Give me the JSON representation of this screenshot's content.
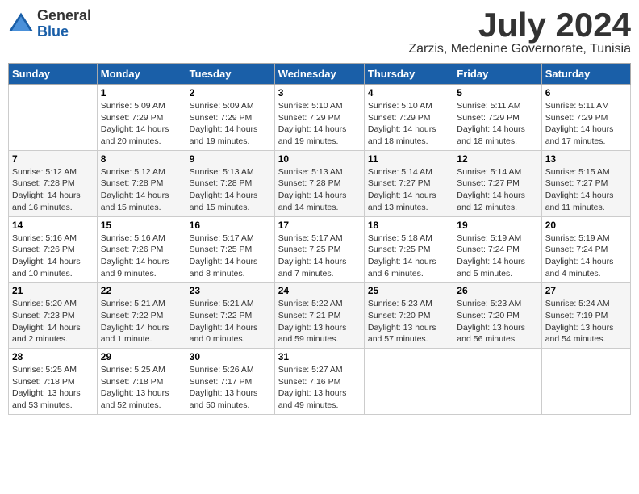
{
  "logo": {
    "general": "General",
    "blue": "Blue"
  },
  "title": {
    "month": "July 2024",
    "location": "Zarzis, Medenine Governorate, Tunisia"
  },
  "headers": [
    "Sunday",
    "Monday",
    "Tuesday",
    "Wednesday",
    "Thursday",
    "Friday",
    "Saturday"
  ],
  "weeks": [
    [
      {
        "day": "",
        "info": ""
      },
      {
        "day": "1",
        "info": "Sunrise: 5:09 AM\nSunset: 7:29 PM\nDaylight: 14 hours\nand 20 minutes."
      },
      {
        "day": "2",
        "info": "Sunrise: 5:09 AM\nSunset: 7:29 PM\nDaylight: 14 hours\nand 19 minutes."
      },
      {
        "day": "3",
        "info": "Sunrise: 5:10 AM\nSunset: 7:29 PM\nDaylight: 14 hours\nand 19 minutes."
      },
      {
        "day": "4",
        "info": "Sunrise: 5:10 AM\nSunset: 7:29 PM\nDaylight: 14 hours\nand 18 minutes."
      },
      {
        "day": "5",
        "info": "Sunrise: 5:11 AM\nSunset: 7:29 PM\nDaylight: 14 hours\nand 18 minutes."
      },
      {
        "day": "6",
        "info": "Sunrise: 5:11 AM\nSunset: 7:29 PM\nDaylight: 14 hours\nand 17 minutes."
      }
    ],
    [
      {
        "day": "7",
        "info": "Sunrise: 5:12 AM\nSunset: 7:28 PM\nDaylight: 14 hours\nand 16 minutes."
      },
      {
        "day": "8",
        "info": "Sunrise: 5:12 AM\nSunset: 7:28 PM\nDaylight: 14 hours\nand 15 minutes."
      },
      {
        "day": "9",
        "info": "Sunrise: 5:13 AM\nSunset: 7:28 PM\nDaylight: 14 hours\nand 15 minutes."
      },
      {
        "day": "10",
        "info": "Sunrise: 5:13 AM\nSunset: 7:28 PM\nDaylight: 14 hours\nand 14 minutes."
      },
      {
        "day": "11",
        "info": "Sunrise: 5:14 AM\nSunset: 7:27 PM\nDaylight: 14 hours\nand 13 minutes."
      },
      {
        "day": "12",
        "info": "Sunrise: 5:14 AM\nSunset: 7:27 PM\nDaylight: 14 hours\nand 12 minutes."
      },
      {
        "day": "13",
        "info": "Sunrise: 5:15 AM\nSunset: 7:27 PM\nDaylight: 14 hours\nand 11 minutes."
      }
    ],
    [
      {
        "day": "14",
        "info": "Sunrise: 5:16 AM\nSunset: 7:26 PM\nDaylight: 14 hours\nand 10 minutes."
      },
      {
        "day": "15",
        "info": "Sunrise: 5:16 AM\nSunset: 7:26 PM\nDaylight: 14 hours\nand 9 minutes."
      },
      {
        "day": "16",
        "info": "Sunrise: 5:17 AM\nSunset: 7:25 PM\nDaylight: 14 hours\nand 8 minutes."
      },
      {
        "day": "17",
        "info": "Sunrise: 5:17 AM\nSunset: 7:25 PM\nDaylight: 14 hours\nand 7 minutes."
      },
      {
        "day": "18",
        "info": "Sunrise: 5:18 AM\nSunset: 7:25 PM\nDaylight: 14 hours\nand 6 minutes."
      },
      {
        "day": "19",
        "info": "Sunrise: 5:19 AM\nSunset: 7:24 PM\nDaylight: 14 hours\nand 5 minutes."
      },
      {
        "day": "20",
        "info": "Sunrise: 5:19 AM\nSunset: 7:24 PM\nDaylight: 14 hours\nand 4 minutes."
      }
    ],
    [
      {
        "day": "21",
        "info": "Sunrise: 5:20 AM\nSunset: 7:23 PM\nDaylight: 14 hours\nand 2 minutes."
      },
      {
        "day": "22",
        "info": "Sunrise: 5:21 AM\nSunset: 7:22 PM\nDaylight: 14 hours\nand 1 minute."
      },
      {
        "day": "23",
        "info": "Sunrise: 5:21 AM\nSunset: 7:22 PM\nDaylight: 14 hours\nand 0 minutes."
      },
      {
        "day": "24",
        "info": "Sunrise: 5:22 AM\nSunset: 7:21 PM\nDaylight: 13 hours\nand 59 minutes."
      },
      {
        "day": "25",
        "info": "Sunrise: 5:23 AM\nSunset: 7:20 PM\nDaylight: 13 hours\nand 57 minutes."
      },
      {
        "day": "26",
        "info": "Sunrise: 5:23 AM\nSunset: 7:20 PM\nDaylight: 13 hours\nand 56 minutes."
      },
      {
        "day": "27",
        "info": "Sunrise: 5:24 AM\nSunset: 7:19 PM\nDaylight: 13 hours\nand 54 minutes."
      }
    ],
    [
      {
        "day": "28",
        "info": "Sunrise: 5:25 AM\nSunset: 7:18 PM\nDaylight: 13 hours\nand 53 minutes."
      },
      {
        "day": "29",
        "info": "Sunrise: 5:25 AM\nSunset: 7:18 PM\nDaylight: 13 hours\nand 52 minutes."
      },
      {
        "day": "30",
        "info": "Sunrise: 5:26 AM\nSunset: 7:17 PM\nDaylight: 13 hours\nand 50 minutes."
      },
      {
        "day": "31",
        "info": "Sunrise: 5:27 AM\nSunset: 7:16 PM\nDaylight: 13 hours\nand 49 minutes."
      },
      {
        "day": "",
        "info": ""
      },
      {
        "day": "",
        "info": ""
      },
      {
        "day": "",
        "info": ""
      }
    ]
  ]
}
